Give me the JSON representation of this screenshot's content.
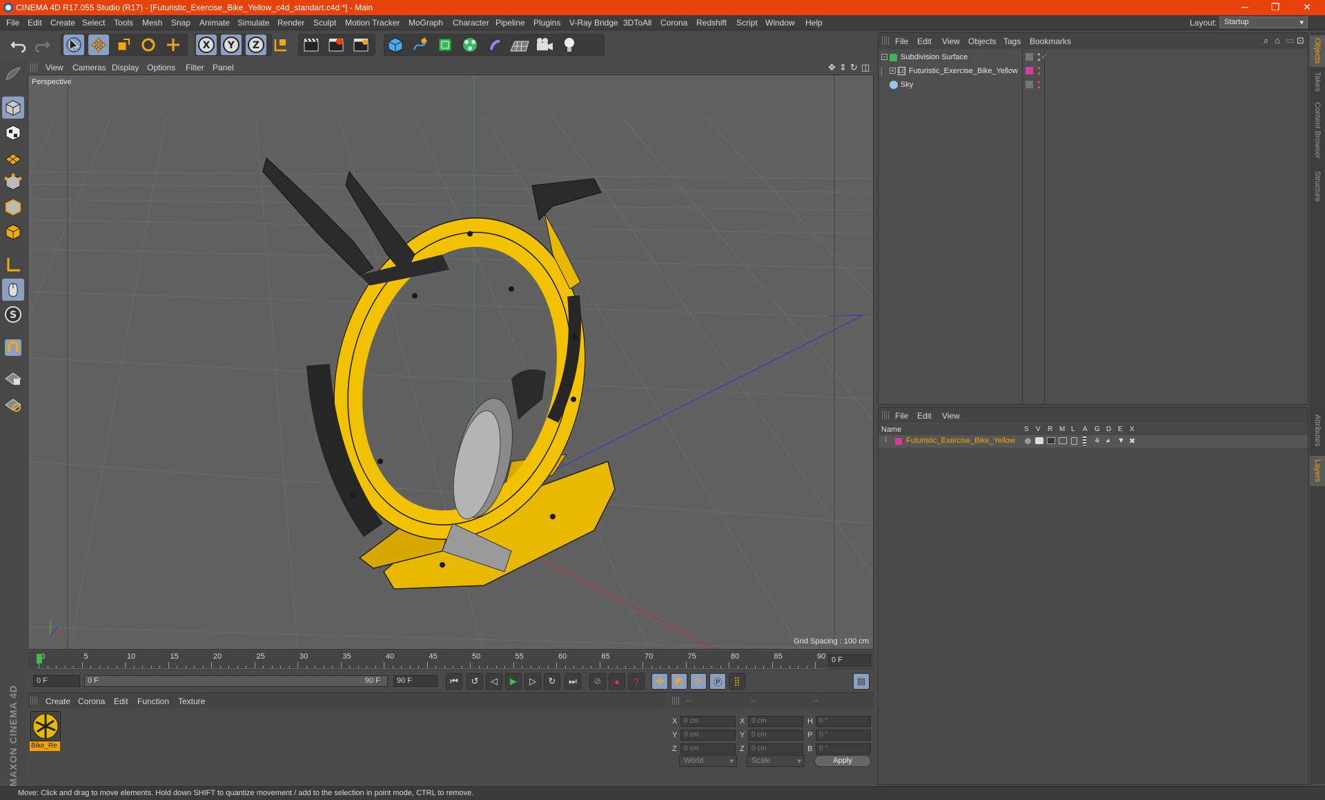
{
  "title": "CINEMA 4D R17.055 Studio (R17) - [Futuristic_Exercise_Bike_Yellow_c4d_standart.c4d *] - Main",
  "window_controls": [
    "─",
    "❐",
    "✕"
  ],
  "menu": [
    "File",
    "Edit",
    "Create",
    "Select",
    "Tools",
    "Mesh",
    "Snap",
    "Animate",
    "Simulate",
    "Render",
    "Sculpt",
    "Motion Tracker",
    "MoGraph",
    "Character",
    "Pipeline",
    "Plugins",
    "V-Ray Bridge",
    "3DToAll",
    "Corona",
    "Redshift",
    "Script",
    "Window",
    "Help"
  ],
  "layout": {
    "label": "Layout:",
    "value": "Startup"
  },
  "axis_buttons": [
    "X",
    "Y",
    "Z"
  ],
  "viewport": {
    "menu": [
      "View",
      "Cameras",
      "Display",
      "Options",
      "Filter",
      "Panel"
    ],
    "camera": "Perspective",
    "grid_spacing": "Grid Spacing : 100 cm"
  },
  "timeline": {
    "ticks": [
      "0",
      "5",
      "10",
      "15",
      "20",
      "25",
      "30",
      "35",
      "40",
      "45",
      "50",
      "55",
      "60",
      "65",
      "70",
      "75",
      "80",
      "85",
      "90"
    ],
    "current": "0 F",
    "start": "0 F",
    "range_start": "0 F",
    "range_end": "90 F",
    "end": "90 F"
  },
  "material_panel": {
    "menu": [
      "Create",
      "Corona",
      "Edit",
      "Function",
      "Texture"
    ],
    "material_name": "Bike_Re"
  },
  "coords": {
    "headers": [
      "--",
      "--",
      "--"
    ],
    "rows": [
      {
        "a": "X",
        "av": "0 cm",
        "b": "X",
        "bv": "0 cm",
        "c": "H",
        "cv": "0 °"
      },
      {
        "a": "Y",
        "av": "0 cm",
        "b": "Y",
        "bv": "0 cm",
        "c": "P",
        "cv": "0 °"
      },
      {
        "a": "Z",
        "av": "0 cm",
        "b": "Z",
        "bv": "0 cm",
        "c": "B",
        "cv": "0 °"
      }
    ],
    "space": "World",
    "mode": "Scale",
    "apply": "Apply"
  },
  "object_manager": {
    "menu": [
      "File",
      "Edit",
      "View",
      "Objects",
      "Tags",
      "Bookmarks"
    ],
    "objects": [
      {
        "name": "Subdivision Surface",
        "indent": 0,
        "icon": "subdivision-icon"
      },
      {
        "name": "Futuristic_Exercise_Bike_Yellow",
        "indent": 1,
        "icon": "null-object-icon"
      },
      {
        "name": "Sky",
        "indent": 0,
        "icon": "sky-icon"
      }
    ]
  },
  "layer_manager": {
    "menu": [
      "File",
      "Edit",
      "View"
    ],
    "name_header": "Name",
    "columns": [
      "S",
      "V",
      "R",
      "M",
      "L",
      "A",
      "G",
      "D",
      "E",
      "X"
    ],
    "layers": [
      {
        "name": "Futuristic_Exercise_Bike_Yellow",
        "color": "#d63ca0"
      }
    ]
  },
  "right_tabs_top": [
    "Objects",
    "Takes",
    "Content Browser",
    "Structure"
  ],
  "right_tabs_bottom": [
    "Attributes",
    "Layers"
  ],
  "status": "Move: Click and drag to move elements. Hold down SHIFT to quantize movement / add to the selection in point mode, CTRL to remove.",
  "brand": "MAXON CINEMA 4D",
  "colors": {
    "accent": "#e8420c",
    "selection": "#8ba0c0",
    "bike_yellow": "#f2c200",
    "layer_text": "#f5a300"
  }
}
